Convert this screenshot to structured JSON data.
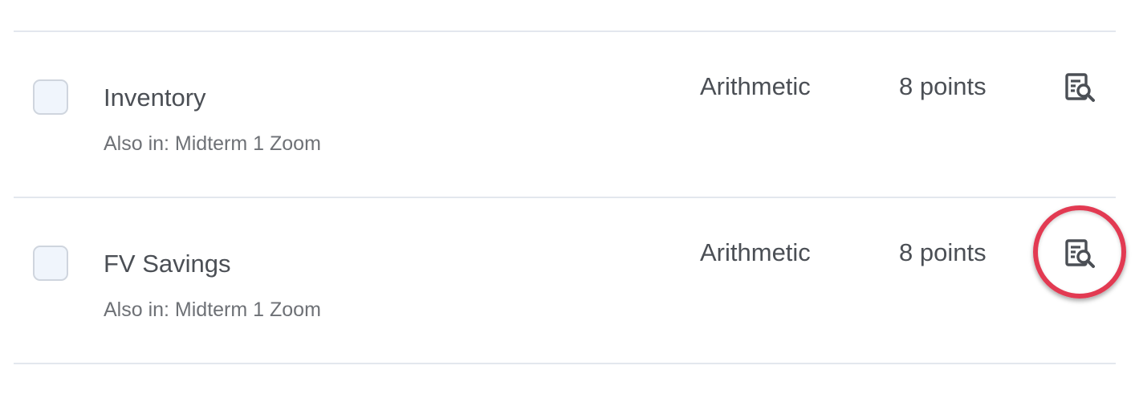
{
  "questions": [
    {
      "title": "Inventory",
      "also_in": "Also in: Midterm 1 Zoom",
      "type": "Arithmetic",
      "points": "8 points",
      "preview_icon": "preview-search-icon"
    },
    {
      "title": "FV Savings",
      "also_in": "Also in: Midterm 1 Zoom",
      "type": "Arithmetic",
      "points": "8 points",
      "preview_icon": "preview-search-icon",
      "highlighted": true
    }
  ],
  "colors": {
    "highlight_ring": "#e23a52",
    "divider": "#e3e7ee",
    "checkbox_fill": "#f0f5fc",
    "checkbox_border": "#cfd5de",
    "text_primary": "#4b4f55",
    "text_secondary": "#6e7176"
  }
}
